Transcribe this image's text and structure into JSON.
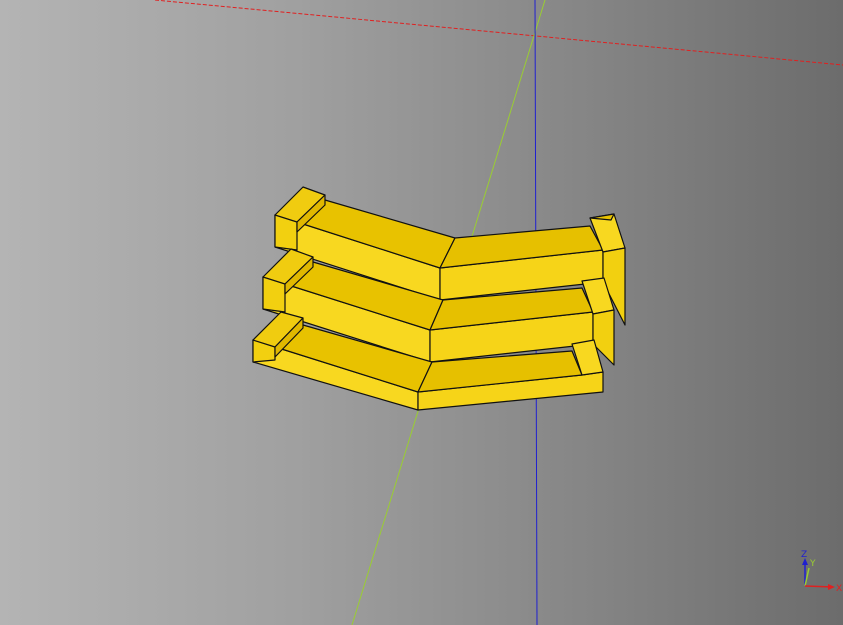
{
  "viewer": {
    "background_colors": [
      "#b4b4b4",
      "#6c6c6c"
    ],
    "model": {
      "description_name": "stacked-angled-shelves",
      "tier_count": 3,
      "colors": {
        "top": "#e8c200",
        "front": "#f8d820",
        "side": "#f2d010",
        "edge": "#111111"
      }
    },
    "axes": {
      "x": {
        "label": "X",
        "color": "#e02020"
      },
      "y": {
        "label": "Y",
        "color": "#9acd32"
      },
      "z": {
        "label": "Z",
        "color": "#2020d0"
      }
    }
  }
}
